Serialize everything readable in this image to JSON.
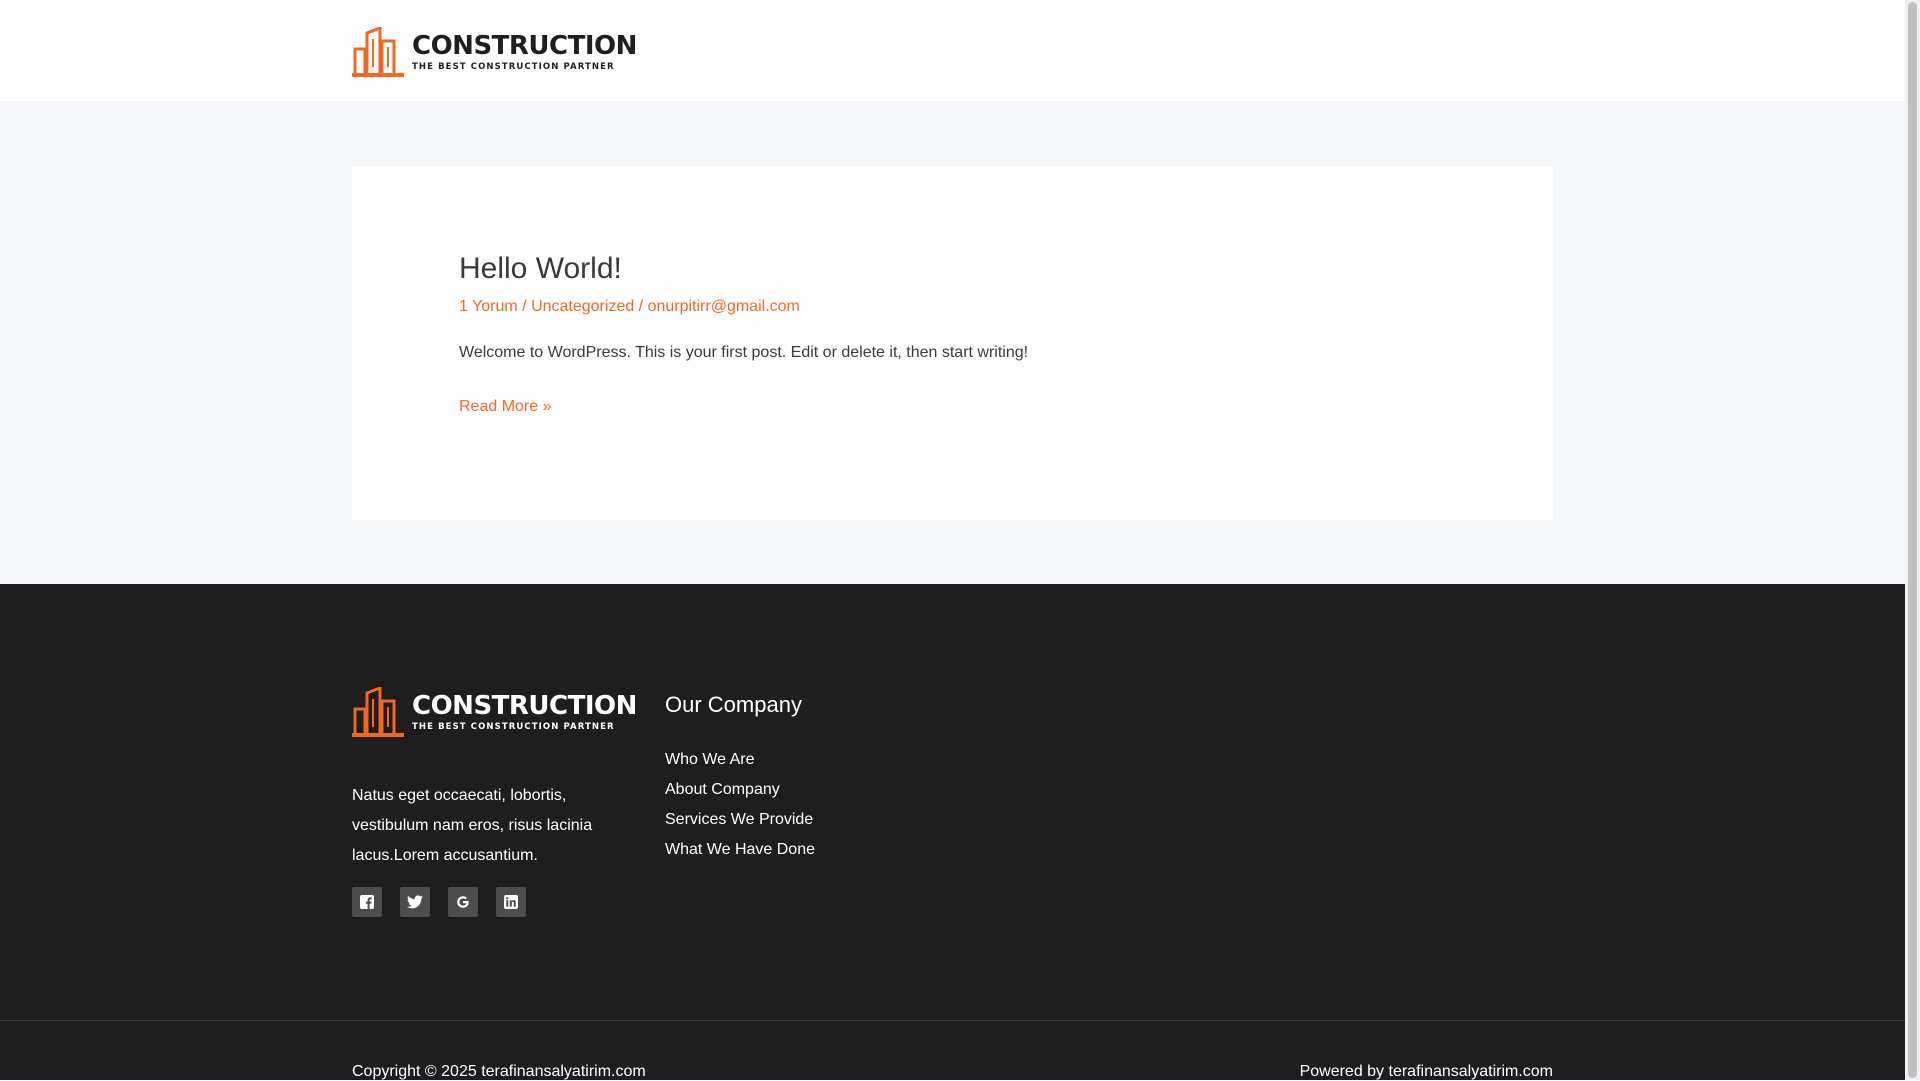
{
  "header": {
    "logo": {
      "title": "CONSTRUCTION",
      "subtitle": "THE BEST CONSTRUCTION PARTNER"
    }
  },
  "post": {
    "title": "Hello World!",
    "meta": {
      "comments": "1 Yorum",
      "separator": " / ",
      "category": "Uncategorized",
      "author": "onurpitirr@gmail.com"
    },
    "excerpt": "Welcome to WordPress. This is your first post. Edit or delete it, then start writing!",
    "read_more": "Read More »"
  },
  "footer": {
    "logo": {
      "title": "CONSTRUCTION",
      "subtitle": "THE BEST CONSTRUCTION PARTNER"
    },
    "about_text": "Natus eget occaecati, lobortis, vestibulum nam eros, risus lacinia lacus.Lorem accusantium.",
    "social": [
      "facebook-icon",
      "twitter-icon",
      "google-icon",
      "linkedin-icon"
    ],
    "widget": {
      "title": "Our Company",
      "links": [
        "Who We Are",
        "About Company",
        "Services We Provide",
        "What We Have Done"
      ]
    },
    "copyright": "Copyright © 2025 terafinansalyatirim.com",
    "powered": "Powered by terafinansalyatirim.com"
  },
  "colors": {
    "accent": "#f26722",
    "footer_bg": "#1e1e1e",
    "page_bg": "#f5f7fa",
    "social_bg": "#4d4d4d"
  }
}
